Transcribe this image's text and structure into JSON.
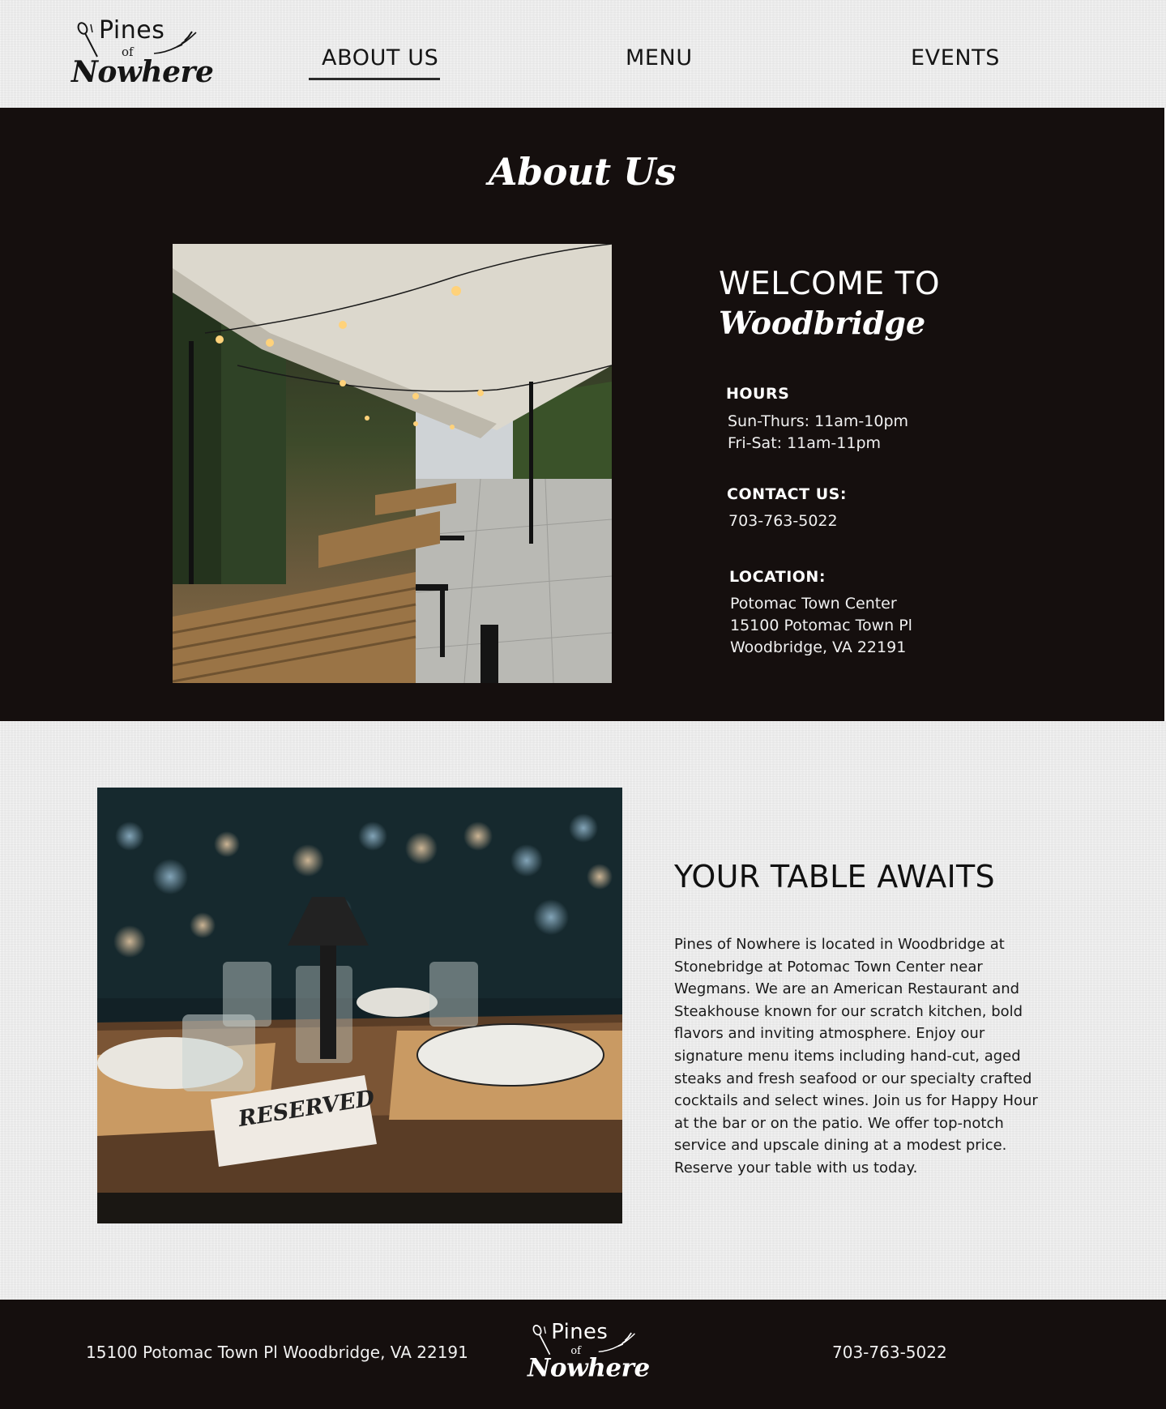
{
  "brand": {
    "line1": "Pines",
    "line2": "of",
    "line3": "Nowhere"
  },
  "nav": {
    "items": [
      {
        "label": "ABOUT US",
        "active": true
      },
      {
        "label": "MENU",
        "active": false
      },
      {
        "label": "EVENTS",
        "active": false
      }
    ]
  },
  "about": {
    "heading": "About Us",
    "welcome_line1": "WELCOME TO",
    "welcome_line2": "Woodbridge",
    "hours": {
      "title": "HOURS",
      "lines": [
        "Sun-Thurs: 11am-10pm",
        "Fri-Sat: 11am-11pm"
      ]
    },
    "contact": {
      "title": "CONTACT US:",
      "phone": "703-763-5022"
    },
    "location": {
      "title": "LOCATION:",
      "lines": [
        "Potomac Town Center",
        "15100 Potomac Town Pl",
        "Woodbridge, VA 22191"
      ]
    }
  },
  "table_section": {
    "heading": "YOUR TABLE AWAITS",
    "paragraph": "Pines of Nowhere is located in Woodbridge at Stonebridge at Potomac Town Center near Wegmans. We are an American Restaurant and Steakhouse known for our scratch kitchen, bold flavors and inviting atmosphere. Enjoy our signature menu items including hand-cut, aged steaks and fresh seafood or our specialty crafted cocktails and select wines. Join us for Happy Hour at the bar or on the patio. We offer top-notch service and upscale dining at a modest price. Reserve your table with us today.",
    "sign_text": "RESERVED"
  },
  "footer": {
    "address": "15100 Potomac Town Pl Woodbridge, VA 22191",
    "phone": "703-763-5022"
  },
  "colors": {
    "dark": "#150f0e",
    "light": "#ebebeb",
    "text_dark": "#151515",
    "text_light": "#ffffff"
  },
  "icons": [
    "spoon-fork-icon",
    "wheat-sprig-icon"
  ]
}
